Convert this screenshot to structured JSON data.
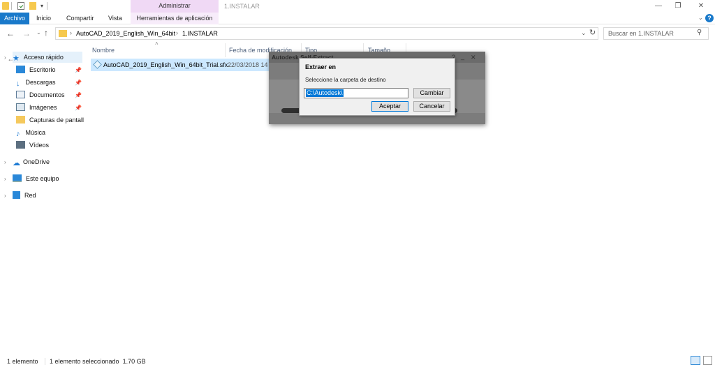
{
  "titlebar": {
    "context_tab_group": "Administrar",
    "window_title": "1.INSTALAR",
    "controls": [
      "—",
      "❐",
      "✕"
    ]
  },
  "ribbon": {
    "tabs": [
      "Archivo",
      "Inicio",
      "Compartir",
      "Vista",
      "Herramientas de aplicación"
    ],
    "help": "?"
  },
  "address": {
    "breadcrumb": [
      "AutoCAD_2019_English_Win_64bit",
      "1.INSTALAR"
    ],
    "search_placeholder": "Buscar en 1.INSTALAR"
  },
  "sidebar": {
    "items": [
      {
        "label": "Acceso rápido",
        "icon": "star-icon",
        "color": "#1e7bd4"
      },
      {
        "label": "Escritorio",
        "icon": "desktop-icon",
        "color": "#2a88d8",
        "pinned": true
      },
      {
        "label": "Descargas",
        "icon": "download-icon",
        "color": "#1e7bd4",
        "pinned": true
      },
      {
        "label": "Documentos",
        "icon": "documents-icon",
        "color": "#607d9a",
        "pinned": true
      },
      {
        "label": "Imágenes",
        "icon": "pictures-icon",
        "color": "#5f7d93",
        "pinned": true
      },
      {
        "label": "Capturas de pantall",
        "icon": "folder-icon",
        "color": "#f5c95d"
      },
      {
        "label": "Música",
        "icon": "music-icon",
        "color": "#1e7bd4"
      },
      {
        "label": "Vídeos",
        "icon": "videos-icon",
        "color": "#5c6f80"
      },
      {
        "label": "OneDrive",
        "icon": "cloud-icon",
        "color": "#1e7bd4"
      },
      {
        "label": "Este equipo",
        "icon": "computer-icon",
        "color": "#2a88d8"
      },
      {
        "label": "Red",
        "icon": "network-icon",
        "color": "#2a88d8"
      }
    ]
  },
  "file_list": {
    "columns": [
      "Nombre",
      "Fecha de modificación",
      "Tipo",
      "Tamaño"
    ],
    "rows": [
      {
        "name": "AutoCAD_2019_English_Win_64bit_Trial.sfx",
        "date": "22/03/2018 14"
      }
    ]
  },
  "status": {
    "count": "1 elemento",
    "selection": "1 elemento seleccionado  1.70 GB"
  },
  "sfx_dialog": {
    "title": "Autodesk Self-Extract"
  },
  "extract_dialog": {
    "title": "Extraer en",
    "prompt": "Seleccione la carpeta de destino",
    "path_value": "C:\\Autodesk\\",
    "change_label": "Cambiar",
    "ok_label": "Aceptar",
    "cancel_label": "Cancelar"
  }
}
